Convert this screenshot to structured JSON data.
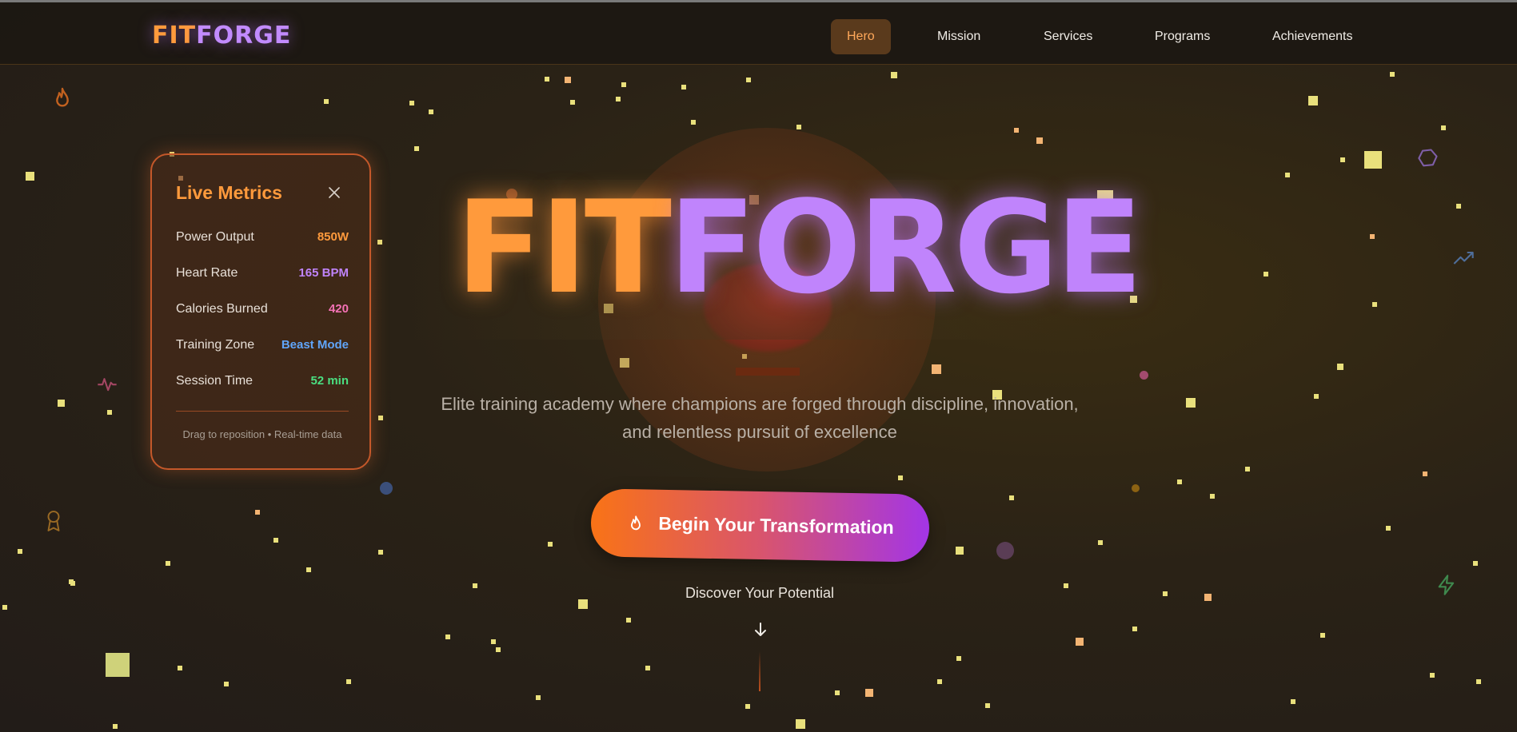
{
  "brand": {
    "part1": "FIT",
    "part2": "FORGE"
  },
  "nav": {
    "items": [
      {
        "label": "Hero",
        "active": true
      },
      {
        "label": "Mission",
        "active": false
      },
      {
        "label": "Services",
        "active": false
      },
      {
        "label": "Programs",
        "active": false
      },
      {
        "label": "Achievements",
        "active": false
      }
    ]
  },
  "hero": {
    "title_part1": "FIT",
    "title_part2": "FORGE",
    "subtitle_line1": "Elite training academy where champions are forged through discipline, innovation,",
    "subtitle_line2": "and relentless pursuit of excellence",
    "cta_label": "Begin Your Transformation",
    "cta_icon": "flame-icon",
    "discover_label": "Discover Your Potential",
    "scroll_icon": "arrow-down-icon"
  },
  "metrics_panel": {
    "title": "Live Metrics",
    "close_icon": "close-icon",
    "rows": [
      {
        "label": "Power Output",
        "value": "850W",
        "color": "#ff9a3c"
      },
      {
        "label": "Heart Rate",
        "value": "165 BPM",
        "color": "#c084fc"
      },
      {
        "label": "Calories Burned",
        "value": "420",
        "color": "#f472b6"
      },
      {
        "label": "Training Zone",
        "value": "Beast Mode",
        "color": "#60a5fa"
      },
      {
        "label": "Session Time",
        "value": "52 min",
        "color": "#4ade80"
      }
    ],
    "footer": "Drag to reposition • Real-time data"
  },
  "decor_icons": [
    "flame-icon",
    "pulse-icon",
    "award-icon",
    "polygon-icon",
    "trending-up-icon",
    "zap-icon"
  ],
  "colors": {
    "accent_orange": "#ff9a3c",
    "accent_purple": "#c084fc",
    "cta_start": "#f97316",
    "cta_end": "#a335e6"
  }
}
